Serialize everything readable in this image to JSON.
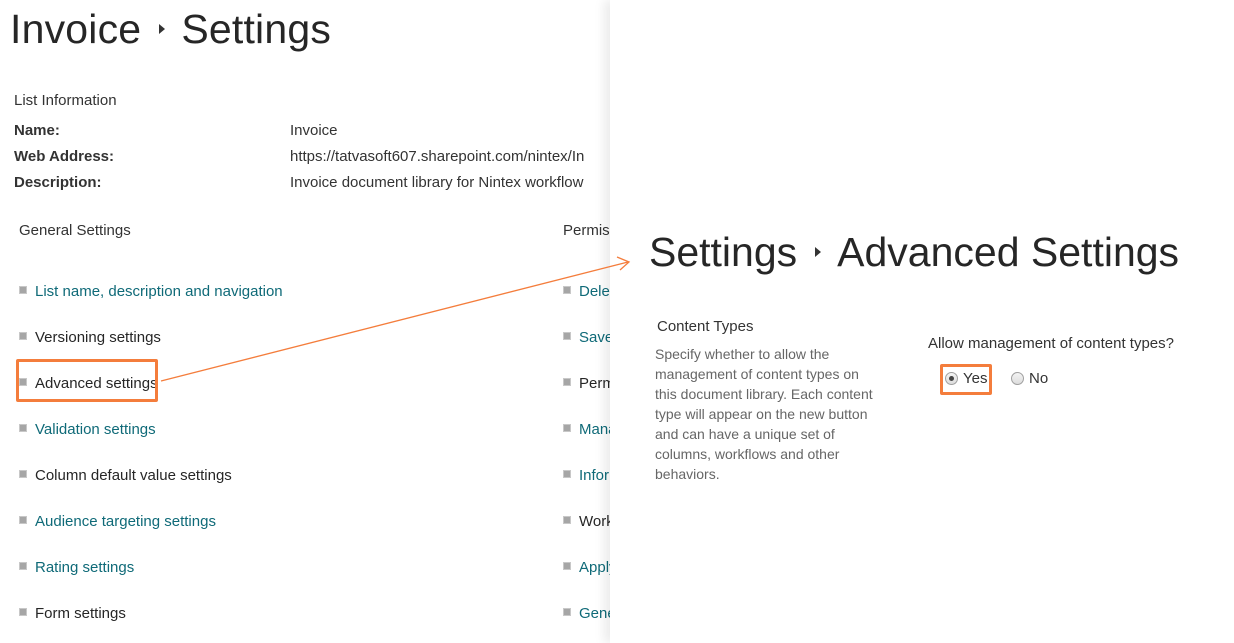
{
  "left_page": {
    "breadcrumb": {
      "parent": "Invoice",
      "current": "Settings"
    },
    "list_information": {
      "heading": "List Information",
      "rows": [
        {
          "key": "Name:",
          "value": "Invoice"
        },
        {
          "key": "Web Address:",
          "value": "https://tatvasoft607.sharepoint.com/nintex/In"
        },
        {
          "key": "Description:",
          "value": "Invoice document library for Nintex workflow"
        }
      ]
    },
    "general_settings": {
      "heading": "General Settings",
      "items": [
        {
          "label": "List name, description and navigation",
          "style": "link"
        },
        {
          "label": "Versioning settings",
          "style": "dark"
        },
        {
          "label": "Advanced settings",
          "style": "dark",
          "highlighted": true
        },
        {
          "label": "Validation settings",
          "style": "link"
        },
        {
          "label": "Column default value settings",
          "style": "dark"
        },
        {
          "label": "Audience targeting settings",
          "style": "link"
        },
        {
          "label": "Rating settings",
          "style": "link"
        },
        {
          "label": "Form settings",
          "style": "dark"
        }
      ]
    },
    "permissions": {
      "heading": "Permis",
      "items": [
        {
          "label": "Delet",
          "style": "link"
        },
        {
          "label": "Save",
          "style": "link"
        },
        {
          "label": "Perm",
          "style": "dark"
        },
        {
          "label": "Mana",
          "style": "link"
        },
        {
          "label": "Infor",
          "style": "link"
        },
        {
          "label": "Work",
          "style": "dark"
        },
        {
          "label": "Apply",
          "style": "link"
        },
        {
          "label": "Gene",
          "style": "link"
        }
      ]
    }
  },
  "right_page": {
    "breadcrumb": {
      "parent": "Settings",
      "current": "Advanced Settings"
    },
    "content_types": {
      "title": "Content Types",
      "description": "Specify whether to allow the management of content types on this document library. Each content type will appear on the new button and can have a unique set of columns, workflows and other behaviors.",
      "question": "Allow management of content types?",
      "options": [
        {
          "label": "Yes",
          "checked": true
        },
        {
          "label": "No",
          "checked": false
        }
      ]
    }
  },
  "annotation": {
    "highlight_color": "#f47d3c"
  },
  "colors": {
    "link": "#0f6a78",
    "text": "#333333",
    "muted": "#666666"
  }
}
